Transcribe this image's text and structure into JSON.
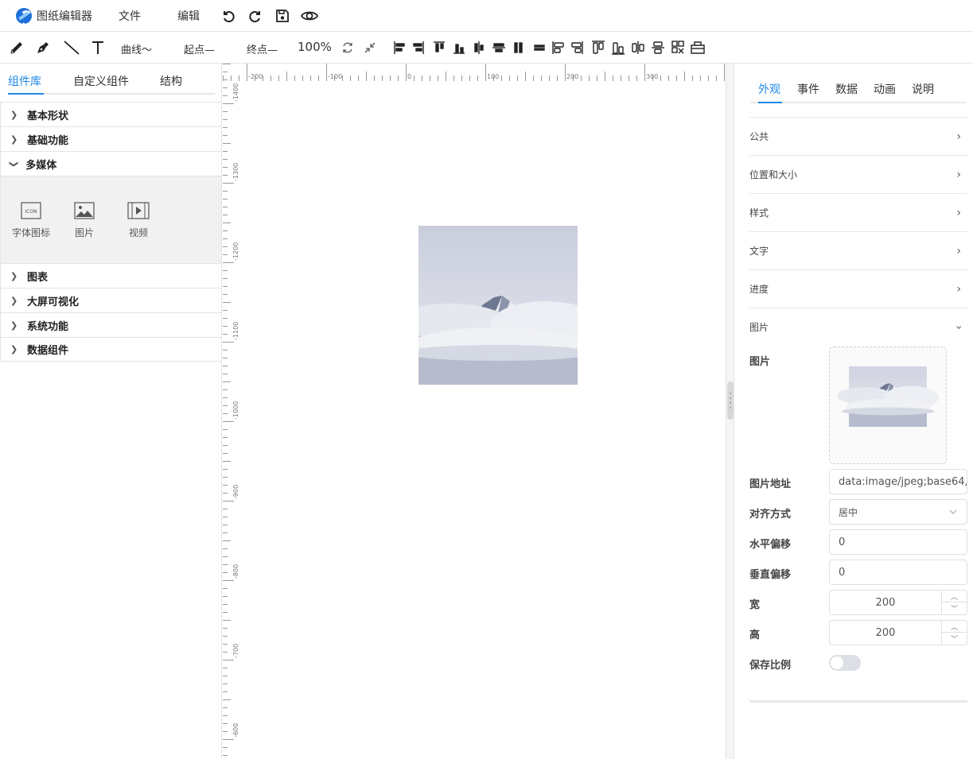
{
  "app": {
    "title": "图纸编辑器"
  },
  "menu": {
    "file": "文件",
    "edit": "编辑"
  },
  "toolbar": {
    "curve": "曲线～",
    "start": "起点—",
    "end": "终点—",
    "zoom": "100%"
  },
  "left": {
    "tabs": [
      "组件库",
      "自定义组件",
      "结构"
    ],
    "groups": {
      "basic": "基本形状",
      "func": "基础功能",
      "media": "多媒体",
      "chart": "图表",
      "bigscreen": "大屏可视化",
      "system": "系统功能",
      "data": "数据组件"
    },
    "media_items": {
      "icon": "字体图标",
      "image": "图片",
      "video": "视频",
      "icon_badge": "ICON"
    }
  },
  "ruler": {
    "h": [
      "-200",
      "-100",
      "0",
      "100",
      "200",
      "300",
      "4"
    ],
    "v": [
      "-1400",
      "-1300",
      "-1200",
      "-1100",
      "-1000",
      "-900",
      "-800",
      "-700",
      "-600"
    ]
  },
  "right": {
    "tabs": [
      "外观",
      "事件",
      "数据",
      "动画",
      "说明"
    ],
    "sections": {
      "common": "公共",
      "pos": "位置和大小",
      "style": "样式",
      "text": "文字",
      "progress": "进度",
      "image": "图片"
    },
    "form": {
      "image_label": "图片",
      "url_label": "图片地址",
      "url_value": "data:image/jpeg;base64,",
      "align_label": "对齐方式",
      "align_value": "居中",
      "hoff_label": "水平偏移",
      "hoff_value": "0",
      "voff_label": "垂直偏移",
      "voff_value": "0",
      "width_label": "宽",
      "width_value": "200",
      "height_label": "高",
      "height_value": "200",
      "ratio_label": "保存比例"
    }
  },
  "colors": {
    "accent": "#1e88e5",
    "border": "#e4e4e4"
  }
}
